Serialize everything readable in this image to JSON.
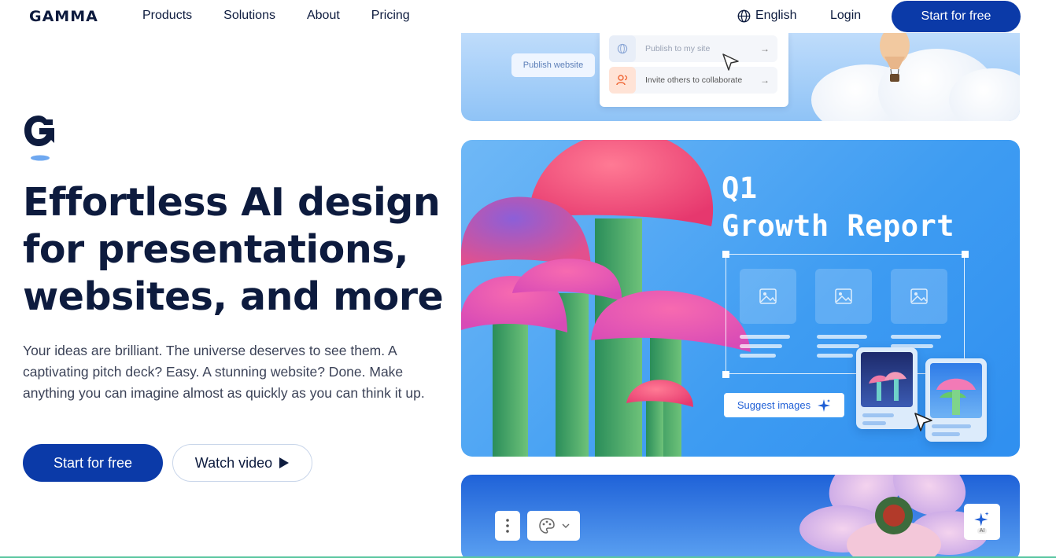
{
  "nav": {
    "logo": "GAMMA",
    "links": [
      "Products",
      "Solutions",
      "About",
      "Pricing"
    ],
    "language": "English",
    "login": "Login",
    "cta": "Start for free"
  },
  "hero": {
    "headline_lines": [
      "Effortless AI design",
      "for presentations,",
      "websites, and more"
    ],
    "subtext": "Your ideas are brilliant. The universe deserves to see them. A captivating pitch deck? Easy. A stunning website? Done. Make anything you can imagine almost as quickly as you can think it up.",
    "primary_cta": "Start for free",
    "secondary_cta": "Watch video"
  },
  "showcase": {
    "top_card": {
      "publish_button": "Publish website",
      "menu_items": [
        {
          "label": "Publish to my site",
          "icon": "globe-icon"
        },
        {
          "label": "Invite others to collaborate",
          "icon": "users-icon"
        }
      ]
    },
    "mid_card": {
      "title_line1": "Q1",
      "title_line2": "Growth Report",
      "suggest_button": "Suggest images"
    },
    "bottom_card": {
      "ai_badge": "AI"
    }
  },
  "colors": {
    "brand": "#0b3aa8",
    "text": "#0d1b3e",
    "accent_blue": "#3e9cf2"
  }
}
